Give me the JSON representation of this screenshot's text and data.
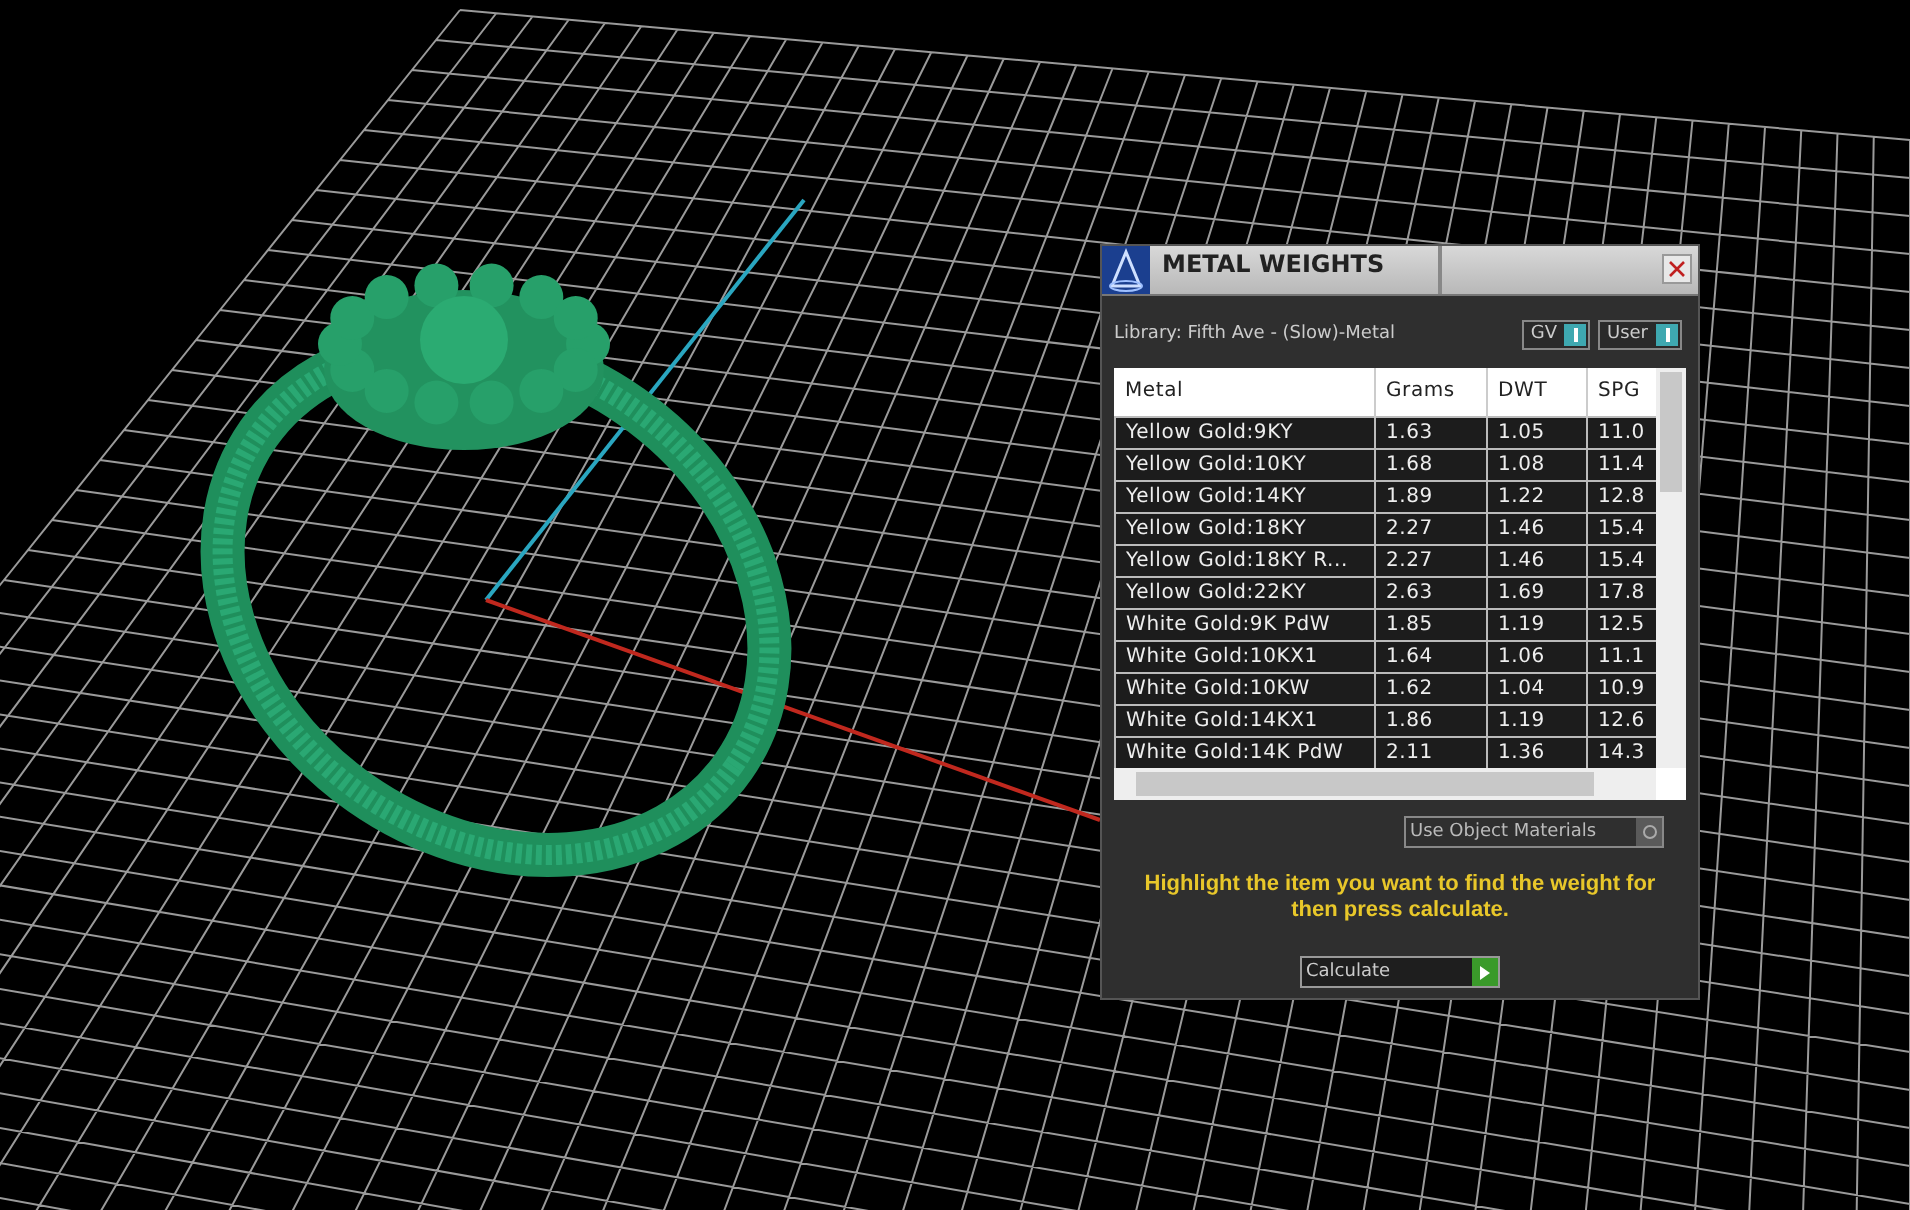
{
  "window": {
    "title": "METAL WEIGHTS"
  },
  "library": "Library: Fifth Ave - (Slow)-Metal",
  "toggles": [
    {
      "label": "GV",
      "on": true
    },
    {
      "label": "User",
      "on": true
    }
  ],
  "table": {
    "columns": [
      "Metal",
      "Grams",
      "DWT",
      "SPG"
    ],
    "rows": [
      [
        "Yellow Gold:9KY",
        "1.63",
        "1.05",
        "11.0"
      ],
      [
        "Yellow Gold:10KY",
        "1.68",
        "1.08",
        "11.4"
      ],
      [
        "Yellow Gold:14KY",
        "1.89",
        "1.22",
        "12.8"
      ],
      [
        "Yellow Gold:18KY",
        "2.27",
        "1.46",
        "15.4"
      ],
      [
        "Yellow Gold:18KY R...",
        "2.27",
        "1.46",
        "15.4"
      ],
      [
        "Yellow Gold:22KY",
        "2.63",
        "1.69",
        "17.8"
      ],
      [
        "White Gold:9K PdW",
        "1.85",
        "1.19",
        "12.5"
      ],
      [
        "White Gold:10KX1",
        "1.64",
        "1.06",
        "11.1"
      ],
      [
        "White Gold:10KW",
        "1.62",
        "1.04",
        "10.9"
      ],
      [
        "White Gold:14KX1",
        "1.86",
        "1.19",
        "12.6"
      ],
      [
        "White Gold:14K PdW",
        "2.11",
        "1.36",
        "14.3"
      ]
    ]
  },
  "use_object_materials": {
    "label": "Use Object Materials",
    "checked": false
  },
  "instruction": "Highlight the item you want to find the weight for then press calculate.",
  "calculate_button": "Calculate"
}
